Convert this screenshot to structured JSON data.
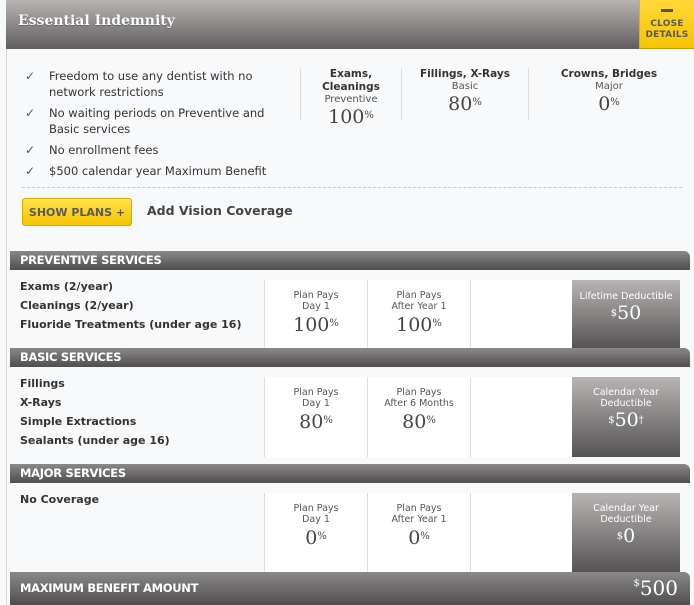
{
  "header": {
    "title": "Essential Indemnity",
    "close_button": {
      "icon": "minus-icon",
      "line1": "CLOSE",
      "line2": "DETAILS"
    }
  },
  "features": [
    "Freedom to use any dentist with no network restrictions",
    "No waiting periods on Preventive and Basic services",
    "No enrollment fees",
    "$500 calendar year Maximum Benefit"
  ],
  "summary": [
    {
      "heading": "Exams, Cleanings",
      "category": "Preventive",
      "value": "100",
      "unit": "%"
    },
    {
      "heading": "Fillings, X-Rays",
      "category": "Basic",
      "value": "80",
      "unit": "%"
    },
    {
      "heading": "Crowns, Bridges",
      "category": "Major",
      "value": "0",
      "unit": "%"
    }
  ],
  "actions": {
    "show_plans_label": "SHOW PLANS +",
    "add_vision_label": "Add Vision Coverage"
  },
  "sections": [
    {
      "title": "PREVENTIVE SERVICES",
      "items": [
        "Exams (2/year)",
        "Cleanings (2/year)",
        "Fluoride Treatments (under age 16)"
      ],
      "pays": [
        {
          "line1": "Plan Pays",
          "line2": "Day 1",
          "value": "100",
          "unit": "%"
        },
        {
          "line1": "Plan Pays",
          "line2": "After Year 1",
          "value": "100",
          "unit": "%"
        }
      ],
      "deductible": {
        "label": "Lifetime Deductible",
        "currency": "$",
        "value": "50",
        "mark": ""
      }
    },
    {
      "title": "BASIC SERVICES",
      "items": [
        "Fillings",
        "X-Rays",
        "Simple Extractions",
        "Sealants (under age 16)"
      ],
      "pays": [
        {
          "line1": "Plan Pays",
          "line2": "Day 1",
          "value": "80",
          "unit": "%"
        },
        {
          "line1": "Plan Pays",
          "line2": "After 6 Months",
          "value": "80",
          "unit": "%"
        }
      ],
      "deductible": {
        "label": "Calendar Year Deductible",
        "currency": "$",
        "value": "50",
        "mark": "†"
      }
    },
    {
      "title": "MAJOR SERVICES",
      "items": [
        "No Coverage"
      ],
      "pays": [
        {
          "line1": "Plan Pays",
          "line2": "Day 1",
          "value": "0",
          "unit": "%"
        },
        {
          "line1": "Plan Pays",
          "line2": "After Year 1",
          "value": "0",
          "unit": "%"
        }
      ],
      "deductible": {
        "label": "Calendar Year Deductible",
        "currency": "$",
        "value": "0",
        "mark": ""
      }
    }
  ],
  "maximum_benefit": {
    "title": "MAXIMUM BENEFIT AMOUNT",
    "currency": "$",
    "value": "500"
  }
}
